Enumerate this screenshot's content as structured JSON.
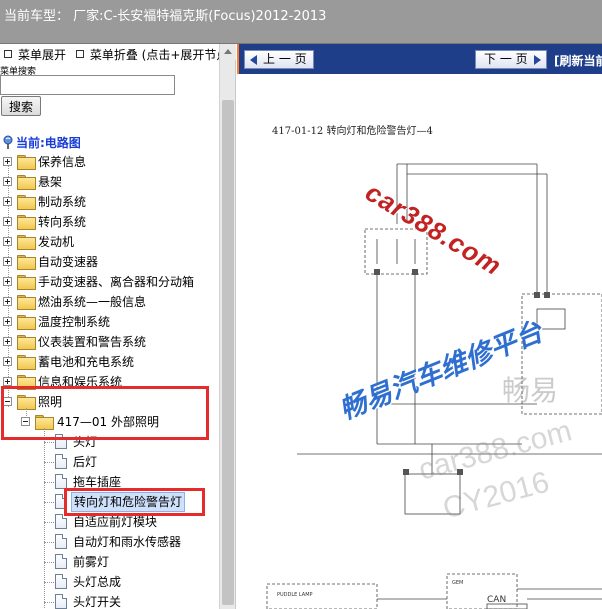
{
  "header": {
    "title": "当前车型： 厂家:C-长安福特福克斯(Focus)2012-2013"
  },
  "menu": {
    "expand": "菜单展开",
    "collapse": "菜单折叠 (点击+展开节点)"
  },
  "search": {
    "label": "菜单搜索",
    "value": "",
    "placeholder": "",
    "button": "搜索"
  },
  "tree": {
    "current": "当前:电路图",
    "items": [
      "保养信息",
      "悬架",
      "制动系统",
      "转向系统",
      "发动机",
      "自动变速器",
      "手动变速器、离合器和分动箱",
      "燃油系统—一般信息",
      "温度控制系统",
      "仪表装置和警告系统",
      "蓄电池和充电系统",
      "信息和娱乐系统",
      "照明"
    ],
    "sub": "417—01 外部照明",
    "docs": [
      "头灯",
      "后灯",
      "拖车插座",
      "转向灯和危险警告灯",
      "自适应前灯模块",
      "自动灯和雨水传感器",
      "前雾灯",
      "头灯总成",
      "头灯开关"
    ]
  },
  "viewer": {
    "prev": "上 一 页",
    "next": "下 一 页",
    "refresh": "[刷新当前页]",
    "page_title": "417-01-12 转向灯和危险警告灯—4",
    "watermarks": {
      "site": "car388.com",
      "platform": "畅易汽车维修平台",
      "brand": "畅易",
      "site2": "car388.com",
      "code": "CY2016"
    },
    "diagram_labels": {
      "can": "CAN",
      "puddle": "PUDDLE LAMP",
      "module": "GEM"
    }
  },
  "colors": {
    "header_bg": "#9a9a9a",
    "nav_bg": "#1f3e8a",
    "selected": "#cfe0fb",
    "highlight": "#e52c2c",
    "watermark_blue": "#2f6fd0",
    "watermark_red": "#c22222"
  }
}
